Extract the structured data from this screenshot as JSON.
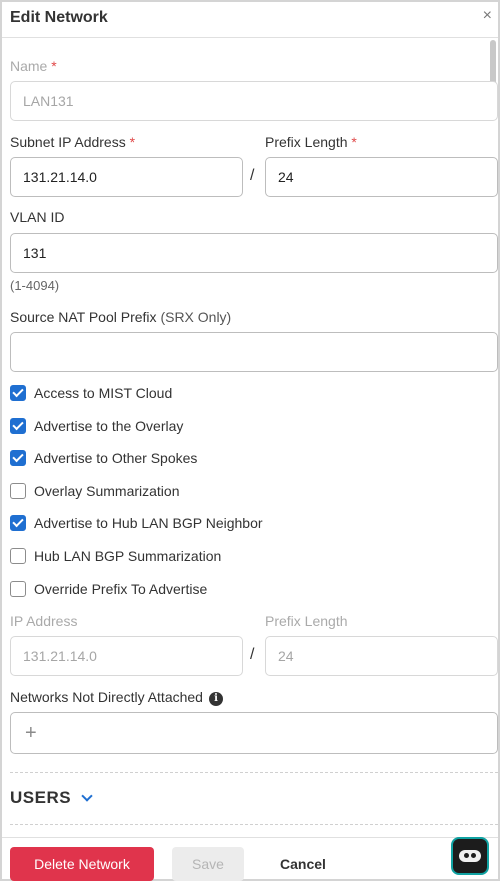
{
  "header": {
    "title": "Edit Network",
    "close_glyph": "×"
  },
  "name": {
    "label": "Name",
    "required_mark": "*",
    "value": "LAN131"
  },
  "subnet": {
    "label": "Subnet IP Address",
    "required_mark": "*",
    "value": "131.21.14.0"
  },
  "prefix": {
    "label": "Prefix Length",
    "required_mark": "*",
    "value": "24"
  },
  "separator": "/",
  "vlan": {
    "label": "VLAN ID",
    "value": "131",
    "hint": "(1-4094)"
  },
  "nat": {
    "label": "Source NAT Pool Prefix",
    "label_suffix": "(SRX Only)",
    "value": ""
  },
  "checkboxes": [
    {
      "label": "Access to MIST Cloud",
      "checked": true
    },
    {
      "label": "Advertise to the Overlay",
      "checked": true
    },
    {
      "label": "Advertise to Other Spokes",
      "checked": true
    },
    {
      "label": "Overlay Summarization",
      "checked": false
    },
    {
      "label": "Advertise to Hub LAN BGP Neighbor",
      "checked": true
    },
    {
      "label": "Hub LAN BGP Summarization",
      "checked": false
    },
    {
      "label": "Override Prefix To Advertise",
      "checked": false
    }
  ],
  "advertise_ip": {
    "label": "IP Address",
    "value": "131.21.14.0"
  },
  "advertise_prefix": {
    "label": "Prefix Length",
    "value": "24"
  },
  "networks_not_attached": {
    "label": "Networks Not Directly Attached",
    "info_glyph": "i",
    "add_glyph": "+"
  },
  "users_section": {
    "title": "USERS"
  },
  "footer": {
    "delete_label": "Delete Network",
    "save_label": "Save",
    "cancel_label": "Cancel"
  },
  "colors": {
    "accent": "#1f6fd1",
    "danger": "#e0344c",
    "required": "#e04848"
  },
  "icons": [
    "close-icon",
    "check-icon",
    "info-icon",
    "plus-icon",
    "chevron-down-icon",
    "chatbot-icon"
  ]
}
